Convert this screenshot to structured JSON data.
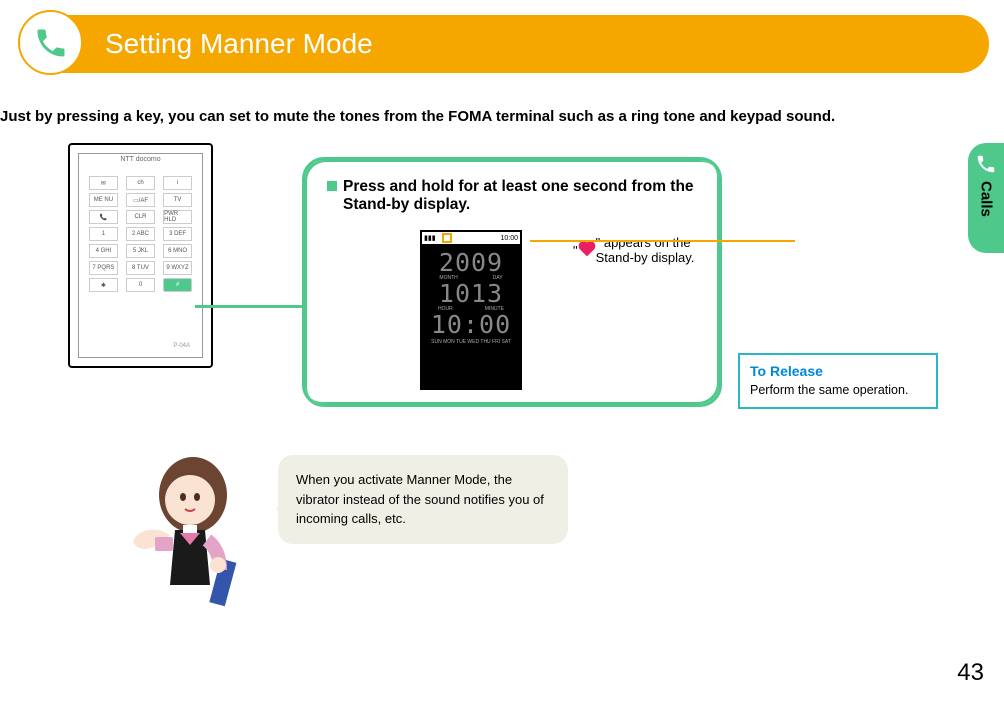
{
  "header": {
    "title": "Setting Manner Mode"
  },
  "intro": "Just by pressing a key, you can set to mute the tones from the FOMA terminal such as a ring tone and keypad sound.",
  "phone": {
    "brand": "NTT docomo",
    "model": "P-04A",
    "keys": {
      "clr": "CLR",
      "menu": "ME NU",
      "tv": "TV",
      "pwr": "PWR HLD"
    }
  },
  "instruction": {
    "title": "Press and hold for at least one second from the Stand-by display.",
    "note_prefix": "\"",
    "note_suffix": "\" appears on the Stand-by display."
  },
  "standby": {
    "year": "2009",
    "month_label": "MONTH",
    "day_label": "DAY",
    "date": "1013",
    "hour_label": "HOUR",
    "minute_label": "MINUTE",
    "time": "10:00",
    "weekdays": "SUN MON TUE WED THU FRI SAT",
    "status_time": "10:00",
    "signal": "▮▮▮"
  },
  "release": {
    "title": "To Release",
    "body": "Perform the same operation."
  },
  "speech": "When you activate Manner Mode, the vibrator instead of the sound notifies you of incoming calls, etc.",
  "sidetab": {
    "label": "Calls"
  },
  "page_number": "43"
}
